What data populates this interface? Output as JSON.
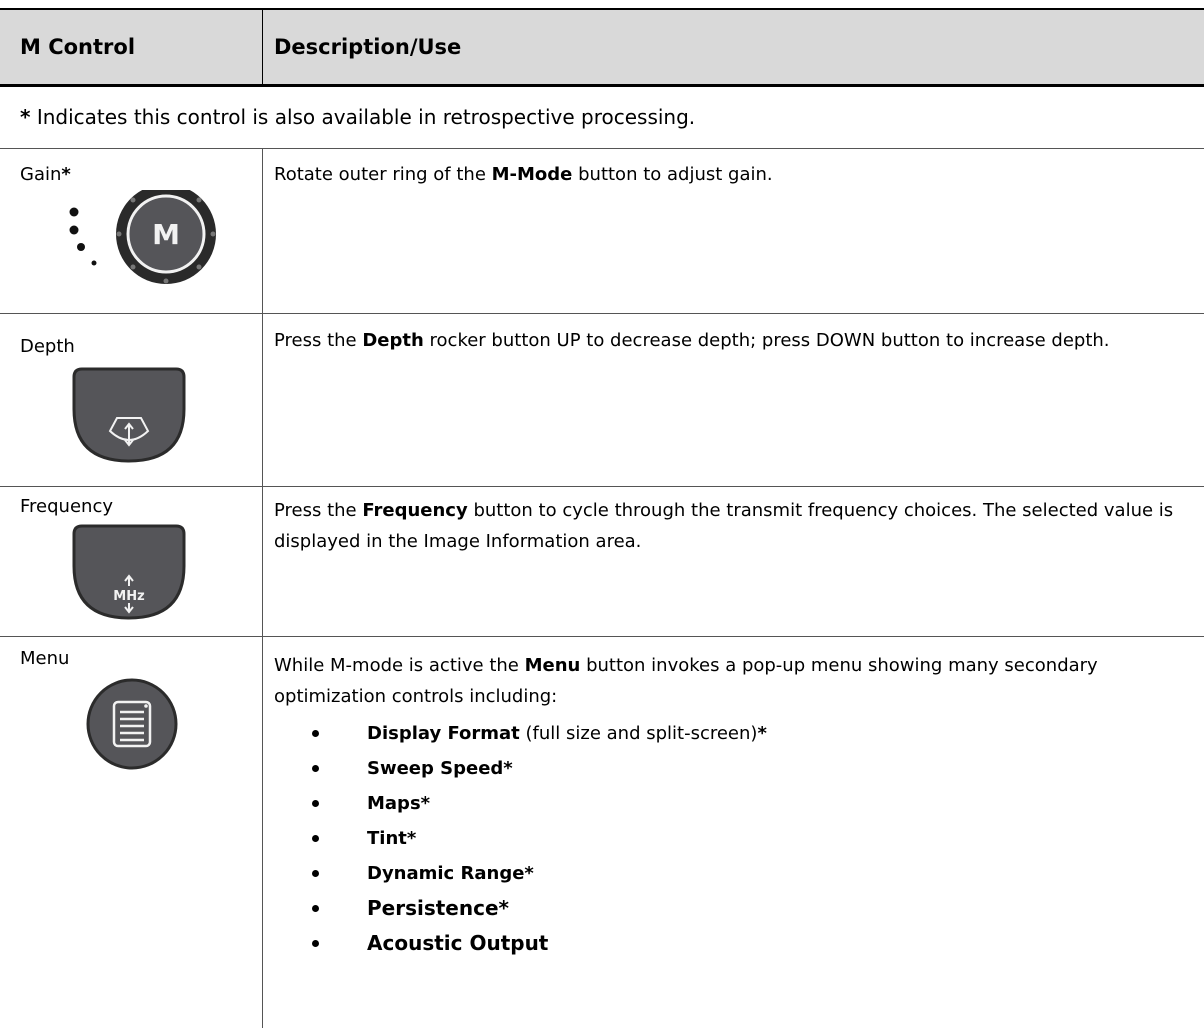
{
  "table": {
    "headers": [
      "M Control",
      "Description/Use"
    ],
    "note": {
      "asterisk": "*",
      "text": " Indicates this control is also available in retrospective processing."
    },
    "rows": [
      {
        "name": "Gain",
        "name_suffix": "*",
        "icon": "m-mode-knob-icon",
        "icon_letter": "M",
        "desc": [
          "Rotate outer ring of the ",
          "M-Mode",
          " button to adjust gain."
        ]
      },
      {
        "name": "Depth",
        "icon": "depth-rocker-icon",
        "desc": [
          "Press the ",
          "Depth",
          " rocker button UP to decrease depth; press DOWN button to increase depth."
        ]
      },
      {
        "name": "Frequency",
        "icon": "frequency-button-icon",
        "icon_label": "MHz",
        "desc": [
          "Press the ",
          "Frequency",
          " button to cycle through the transmit frequency choices. The selected value is displayed in the Image Information area."
        ]
      },
      {
        "name": "Menu",
        "icon": "menu-button-icon",
        "desc": [
          "While M-mode is active the ",
          "Menu",
          " button invokes a pop-up menu showing many secondary optimization controls including:"
        ],
        "bullets": [
          {
            "bold": "Display Format",
            "plain": " (full size and split-screen)",
            "suffix": "*"
          },
          {
            "bold": "Sweep Speed*"
          },
          {
            "bold": "Maps*"
          },
          {
            "bold": "Tint*"
          },
          {
            "bold": "Dynamic Range*"
          },
          {
            "bold": "Persistence*"
          },
          {
            "bold": "Acoustic Output"
          }
        ]
      }
    ]
  },
  "colors": {
    "header_bg": "#d9d9d9",
    "button_dark": "#555559",
    "knob_ring": "#2a2a2a"
  }
}
